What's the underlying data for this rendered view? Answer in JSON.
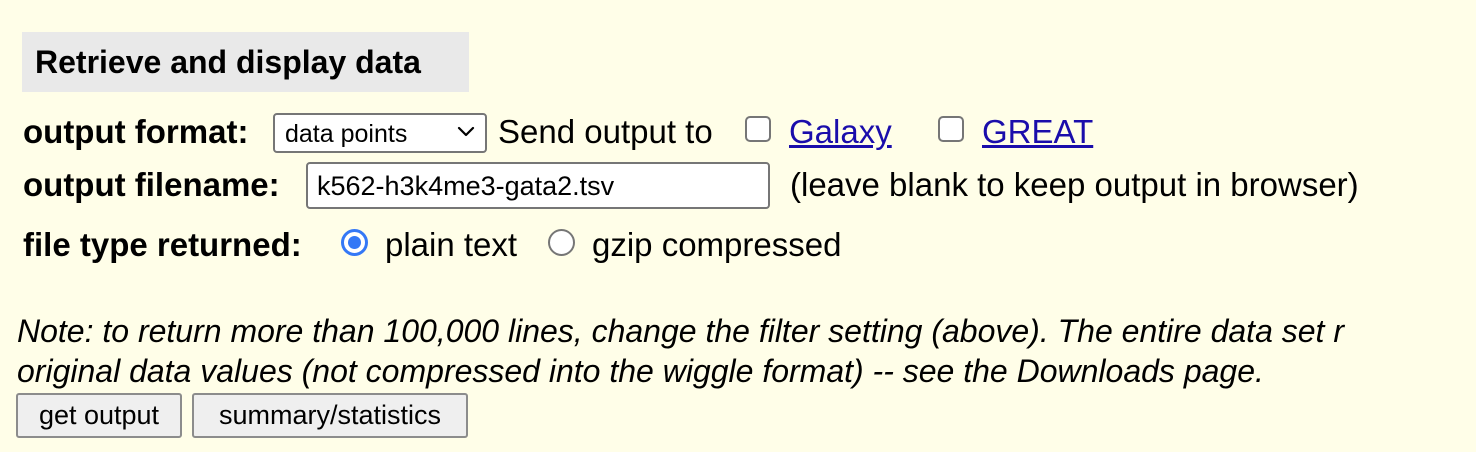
{
  "section": {
    "title": "Retrieve and display data"
  },
  "output_format": {
    "label": "output format:",
    "selected": "data points",
    "send_output_label": "Send output to",
    "targets": [
      {
        "label": "Galaxy",
        "checked": false
      },
      {
        "label": "GREAT",
        "checked": false
      }
    ]
  },
  "output_filename": {
    "label": "output filename:",
    "value": "k562-h3k4me3-gata2.tsv",
    "hint": "(leave blank to keep output in browser)"
  },
  "file_type": {
    "label": "file type returned:",
    "options": [
      {
        "label": "plain text",
        "selected": true
      },
      {
        "label": "gzip compressed",
        "selected": false
      }
    ]
  },
  "note": {
    "line1": "Note: to return more than 100,000 lines, change the filter setting (above). The entire data set r",
    "line2": "original data values (not compressed into the wiggle format) -- see the Downloads page."
  },
  "buttons": {
    "get_output": "get output",
    "summary": "summary/statistics"
  },
  "colors": {
    "background": "#fffee8",
    "link": "#1a0dab",
    "radio_accent": "#3478f6",
    "title_bg": "#e9e9e9"
  },
  "icons": {
    "select_arrow": "chevron-down-icon"
  }
}
